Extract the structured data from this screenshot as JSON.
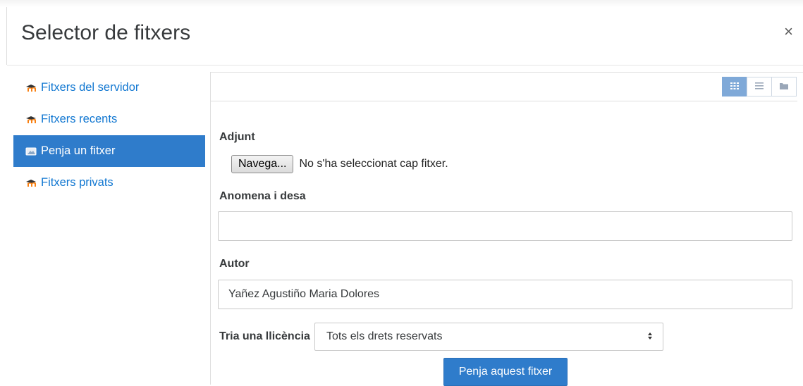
{
  "dialog": {
    "title": "Selector de fitxers",
    "close_label": "×"
  },
  "sidebar": {
    "items": [
      {
        "label": "Fitxers del servidor",
        "icon": "moodle-icon",
        "active": false
      },
      {
        "label": "Fitxers recents",
        "icon": "moodle-icon",
        "active": false
      },
      {
        "label": "Penja un fitxer",
        "icon": "upload-icon",
        "active": true
      },
      {
        "label": "Fitxers privats",
        "icon": "moodle-icon",
        "active": false
      }
    ]
  },
  "toolbar": {
    "views": [
      {
        "name": "icons-view",
        "active": true
      },
      {
        "name": "list-view",
        "active": false
      },
      {
        "name": "tree-view",
        "active": false
      }
    ]
  },
  "form": {
    "attachment_label": "Adjunt",
    "browse_button": "Navega...",
    "no_file_text": "No s'ha seleccionat cap fitxer.",
    "save_as_label": "Anomena i desa",
    "save_as_value": "",
    "author_label": "Autor",
    "author_value": "Yañez Agustiño Maria Dolores",
    "license_label": "Tria una llicència",
    "license_value": "Tots els drets reservats",
    "upload_button": "Penja aquest fitxer"
  },
  "colors": {
    "accent": "#2f7ccb",
    "link": "#1177d1",
    "moodle_orange": "#f98012"
  }
}
